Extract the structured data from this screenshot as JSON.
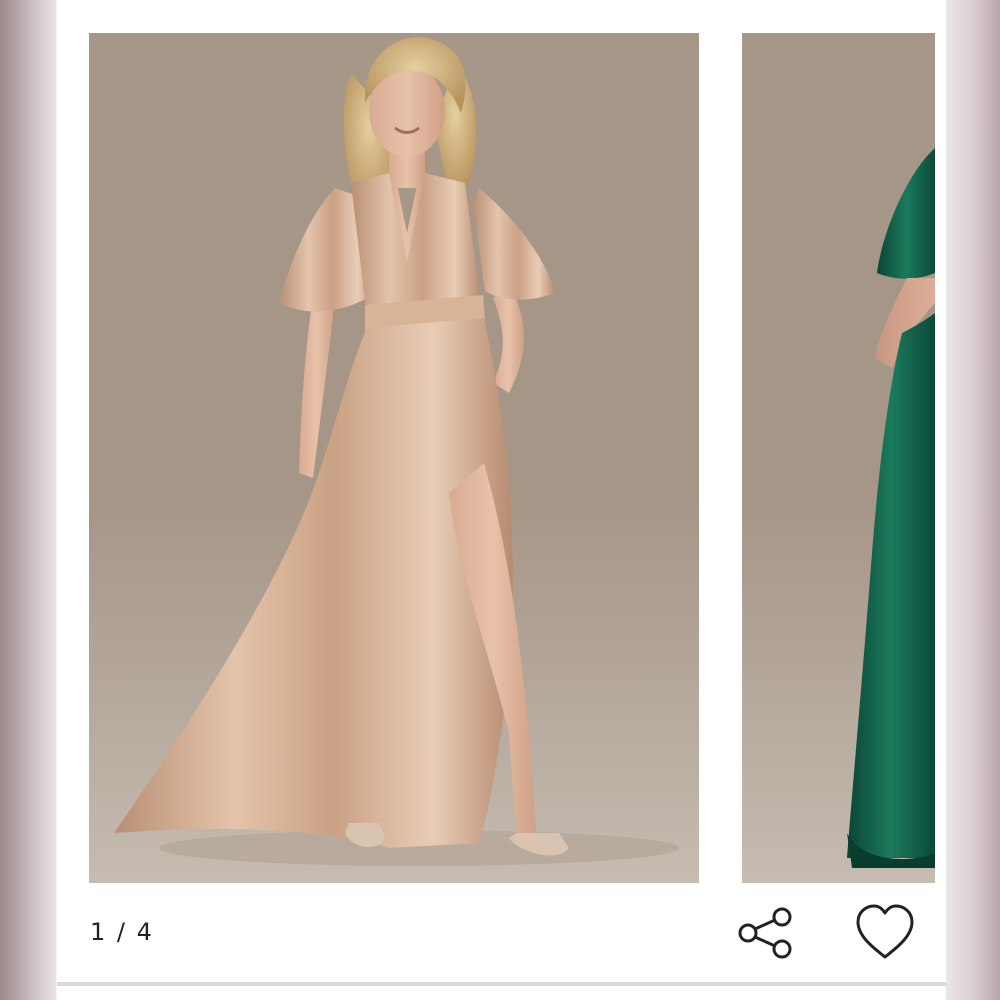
{
  "gallery": {
    "counter": "1 / 4",
    "current_slide": 1,
    "total_slides": 4
  },
  "slides": [
    {
      "icon": "product-photo",
      "dress_color": "#c9a489",
      "background": "#a79789"
    },
    {
      "icon": "product-photo",
      "dress_color": "#0f5a44",
      "background": "#a79789"
    }
  ],
  "actions": {
    "share_icon": "share-icon",
    "favorite_icon": "heart-icon"
  },
  "colors": {
    "panel": "#ffffff",
    "icon_stroke": "#222222",
    "text": "#222222"
  }
}
